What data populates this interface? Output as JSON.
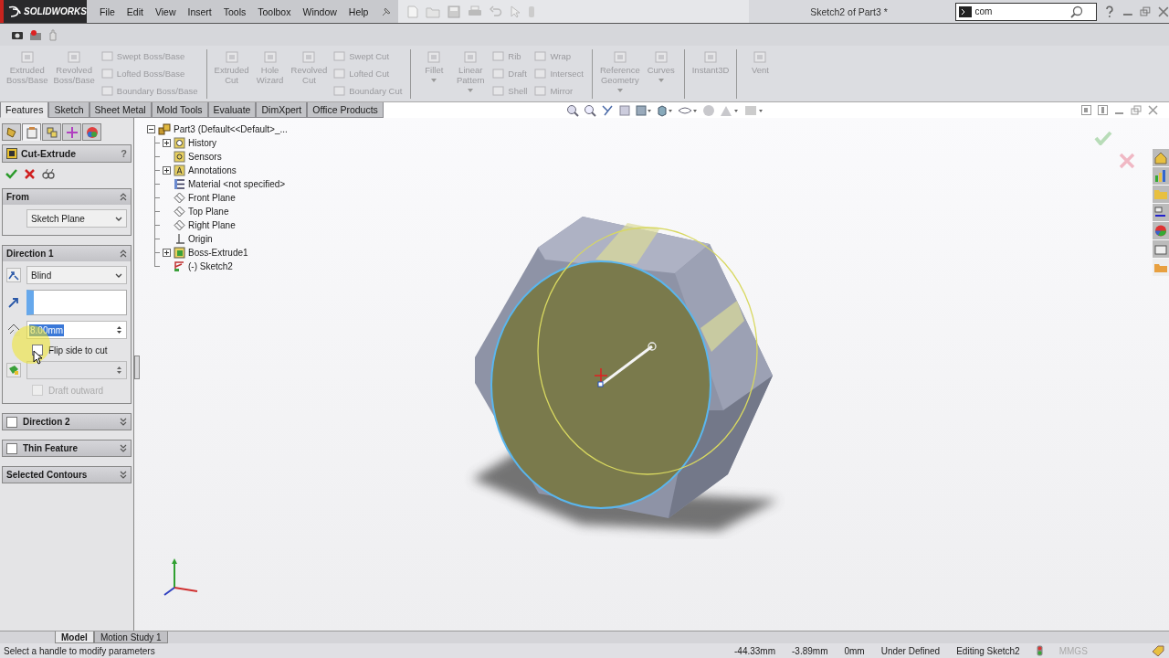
{
  "titlebar": {
    "logo": "SOLIDWORKS",
    "menu": [
      "File",
      "Edit",
      "View",
      "Insert",
      "Tools",
      "Toolbox",
      "Window",
      "Help"
    ],
    "title": "Sketch2 of Part3 *",
    "search": {
      "value": "com"
    }
  },
  "ribbon": {
    "disabled": true,
    "columns": [
      {
        "kind": "large",
        "lines": [
          "Extruded",
          "Boss/Base"
        ],
        "dropdown": false
      },
      {
        "kind": "large",
        "lines": [
          "Revolved",
          "Boss/Base"
        ],
        "dropdown": false
      },
      {
        "kind": "stack",
        "items": [
          "Swept Boss/Base",
          "Lofted Boss/Base",
          "Boundary Boss/Base"
        ]
      },
      {
        "kind": "separator"
      },
      {
        "kind": "large",
        "lines": [
          "Extruded",
          "Cut"
        ],
        "dropdown": false
      },
      {
        "kind": "large",
        "lines": [
          "Hole",
          "Wizard"
        ],
        "dropdown": false
      },
      {
        "kind": "large",
        "lines": [
          "Revolved",
          "Cut"
        ],
        "dropdown": false
      },
      {
        "kind": "stack",
        "items": [
          "Swept Cut",
          "Lofted Cut",
          "Boundary Cut"
        ]
      },
      {
        "kind": "separator"
      },
      {
        "kind": "large",
        "lines": [
          "Fillet"
        ],
        "dropdown": true
      },
      {
        "kind": "large",
        "lines": [
          "Linear",
          "Pattern"
        ],
        "dropdown": true
      },
      {
        "kind": "stack",
        "items": [
          "Rib",
          "Draft",
          "Shell"
        ]
      },
      {
        "kind": "stack",
        "items": [
          "Wrap",
          "Intersect",
          "Mirror"
        ]
      },
      {
        "kind": "separator"
      },
      {
        "kind": "large",
        "lines": [
          "Reference",
          "Geometry"
        ],
        "dropdown": true
      },
      {
        "kind": "large",
        "lines": [
          "Curves"
        ],
        "dropdown": true
      },
      {
        "kind": "separator"
      },
      {
        "kind": "large",
        "lines": [
          "Instant3D"
        ],
        "dropdown": false
      },
      {
        "kind": "separator"
      },
      {
        "kind": "large",
        "lines": [
          "Vent"
        ],
        "dropdown": false
      }
    ]
  },
  "command_tabs": [
    {
      "label": "Features",
      "selected": true
    },
    {
      "label": "Sketch",
      "selected": false
    },
    {
      "label": "Sheet Metal",
      "selected": false
    },
    {
      "label": "Mold Tools",
      "selected": false
    },
    {
      "label": "Evaluate",
      "selected": false
    },
    {
      "label": "DimXpert",
      "selected": false
    },
    {
      "label": "Office Products",
      "selected": false
    }
  ],
  "property_manager": {
    "manager_tabs": [
      {
        "kind": "features",
        "selected": false
      },
      {
        "kind": "property",
        "selected": true
      },
      {
        "kind": "config",
        "selected": false
      },
      {
        "kind": "dimxpert",
        "selected": false
      },
      {
        "kind": "display",
        "selected": false
      }
    ],
    "title": "Cut-Extrude",
    "help": "?",
    "sections": [
      {
        "kind": "from",
        "title": "From",
        "expanded": true,
        "value": "Sketch Plane"
      },
      {
        "kind": "direction",
        "title": "Direction 1",
        "expanded": true,
        "end_condition": "Blind",
        "depth": "8.00mm",
        "depth_selected": true,
        "flip": {
          "label": "Flip side to cut",
          "checked": false
        },
        "draft_outward": {
          "label": "Draft outward",
          "checked": false,
          "disabled": true
        }
      },
      {
        "kind": "check",
        "title": "Direction 2",
        "expanded": false,
        "checked": false
      },
      {
        "kind": "check",
        "title": "Thin Feature",
        "expanded": false,
        "checked": false
      },
      {
        "kind": "plain",
        "title": "Selected Contours",
        "expanded": false
      }
    ]
  },
  "feature_tree": {
    "root": {
      "label": "Part3  (Default<<Default>_...",
      "expanded": true
    },
    "items": [
      {
        "label": "History",
        "kind": "history",
        "has_children": true
      },
      {
        "label": "Sensors",
        "kind": "sensor",
        "has_children": false
      },
      {
        "label": "Annotations",
        "kind": "annotation",
        "has_children": true
      },
      {
        "label": "Material <not specified>",
        "kind": "material",
        "has_children": false
      },
      {
        "label": "Front Plane",
        "kind": "plane",
        "has_children": false
      },
      {
        "label": "Top Plane",
        "kind": "plane",
        "has_children": false
      },
      {
        "label": "Right Plane",
        "kind": "plane",
        "has_children": false
      },
      {
        "label": "Origin",
        "kind": "origin",
        "has_children": false
      },
      {
        "label": "Boss-Extrude1",
        "kind": "extrude",
        "has_children": true
      },
      {
        "label": "(-) Sketch2",
        "kind": "sketch",
        "has_children": false
      }
    ]
  },
  "bottom_tabs": [
    {
      "label": "Model",
      "selected": true
    },
    {
      "label": "Motion Study 1",
      "selected": false
    }
  ],
  "status_bar": {
    "message": "Select a handle to modify parameters",
    "fields": [
      "-44.33mm",
      "-3.89mm",
      "0mm",
      "Under Defined",
      "Editing Sketch2"
    ],
    "units": "MMGS"
  }
}
